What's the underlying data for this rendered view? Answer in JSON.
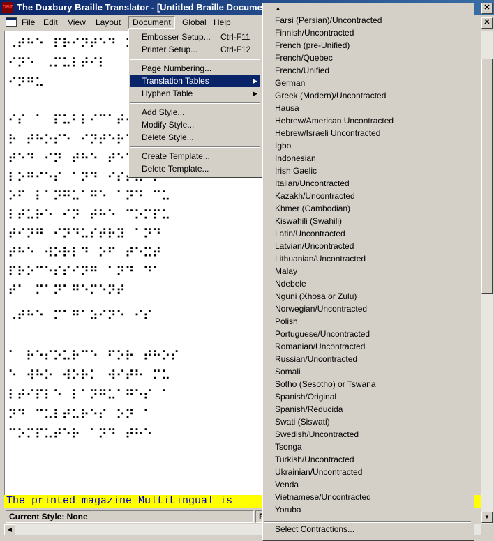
{
  "window": {
    "title": "The Duxbury Braille Translator - [Untitled Braille Document]",
    "icon_text": "DBT"
  },
  "menubar": {
    "items": [
      "File",
      "Edit",
      "View",
      "Layout",
      "Document",
      "Global",
      "Help"
    ],
    "open": "Document"
  },
  "document_menu": {
    "items": [
      {
        "label": "Embosser Setup...",
        "shortcut": "Ctrl-F11"
      },
      {
        "label": "Printer Setup...",
        "shortcut": "Ctrl-F12"
      },
      {
        "label": "Page Numbering..."
      },
      {
        "label": "Translation Tables",
        "submenu": true,
        "highlighted": true
      },
      {
        "label": "Hyphen Table",
        "submenu": true
      },
      {
        "label": "Add Style..."
      },
      {
        "label": "Modify Style..."
      },
      {
        "label": "Delete Style..."
      },
      {
        "label": "Create Template..."
      },
      {
        "label": "Delete Template..."
      }
    ]
  },
  "translation_tables": {
    "items": [
      "Farsi (Persian)/Uncontracted",
      "Finnish/Uncontracted",
      "French (pre-Unified)",
      "French/Quebec",
      "French/Unified",
      "German",
      "Greek (Modern)/Uncontracted",
      "Hausa",
      "Hebrew/American Uncontracted",
      "Hebrew/Israeli Uncontracted",
      "Igbo",
      "Indonesian",
      "Irish Gaelic",
      "Italian/Uncontracted",
      "Kazakh/Uncontracted",
      "Khmer (Cambodian)",
      "Kiswahili (Swahili)",
      "Latin/Uncontracted",
      "Latvian/Uncontracted",
      "Lithuanian/Uncontracted",
      "Malay",
      "Ndebele",
      "Nguni (Xhosa or Zulu)",
      "Norwegian/Uncontracted",
      "Polish",
      "Portuguese/Uncontracted",
      "Romanian/Uncontracted",
      "Russian/Uncontracted",
      "Somali",
      "Sotho (Sesotho) or Tswana",
      "Spanish/Original",
      "Spanish/Reducida",
      "Swati (Siswati)",
      "Swedish/Uncontracted",
      "Tsonga",
      "Turkish/Uncontracted",
      "Ukrainian/Uncontracted",
      "Venda",
      "Vietnamese/Uncontracted",
      "Yoruba"
    ],
    "footer": "Select Contractions..."
  },
  "document": {
    "braille_lines": [
      "⠠⠞⠓⠑⠀⠏⠗⠊⠝⠞⠑⠙⠀⠍⠁⠛⠁⠵",
      "⠊⠝⠑⠀⠠⠍⠥⠇⠞⠊⠇",
      "⠊⠝⠛⠥",
      "",
      "⠊⠎⠀⠁⠀⠏⠥⠃⠇⠊⠉⠁⠞⠊⠕⠝⠀⠋⠕",
      "⠗⠀⠞⠓⠕⠎⠑⠀⠊⠝⠞⠑⠗⠑⠎",
      "⠞⠑⠙⠀⠊⠝⠀⠞⠓⠑⠀⠞⠑⠉⠓⠝⠕",
      "⠇⠕⠛⠊⠑⠎⠀⠁⠝⠙⠀⠊⠎⠎⠥⠑⠎",
      "⠕⠋⠀⠇⠁⠝⠛⠥⠁⠛⠑⠀⠁⠝⠙⠀⠉⠥",
      "⠇⠞⠥⠗⠑⠀⠊⠝⠀⠞⠓⠑⠀⠉⠕⠍⠏⠥",
      "⠞⠊⠝⠛⠀⠊⠝⠙⠥⠎⠞⠗⠽⠀⠁⠝⠙",
      "⠞⠓⠑⠀⠺⠕⠗⠇⠙⠀⠕⠋⠀⠞⠑⠭⠞",
      "⠏⠗⠕⠉⠑⠎⠎⠊⠝⠛⠀⠁⠝⠙⠀⠙⠁",
      "⠞⠁⠀⠍⠁⠝⠁⠛⠑⠍⠑⠝⠞",
      "",
      "⠠⠞⠓⠑⠀⠍⠁⠛⠁⠵⠊⠝⠑⠀⠊⠎",
      "⠁⠀⠗⠑⠎⠕⠥⠗⠉⠑⠀⠋⠕⠗⠀⠞⠓⠕⠎",
      "⠑⠀⠺⠓⠕⠀⠺⠕⠗⠅⠀⠺⠊⠞⠓⠀⠍⠥",
      "⠇⠞⠊⠏⠇⠑⠀⠇⠁⠝⠛⠥⠁⠛⠑⠎⠀⠁",
      "⠝⠙⠀⠉⠥⠇⠞⠥⠗⠑⠎⠀⠕⠝⠀⠁",
      "⠉⠕⠍⠏⠥⠞⠑⠗⠀⠁⠝⠙⠀⠞⠓⠑"
    ],
    "print_text_line": "The printed magazine MultiLingual is"
  },
  "status": {
    "current_style": "Current Style: None",
    "second_pane": "P"
  },
  "colors": {
    "titlebar": "#0a246a",
    "highlight": "#0a246a",
    "print_line_bg": "#ffff00",
    "print_line_text": "#0000c0"
  }
}
